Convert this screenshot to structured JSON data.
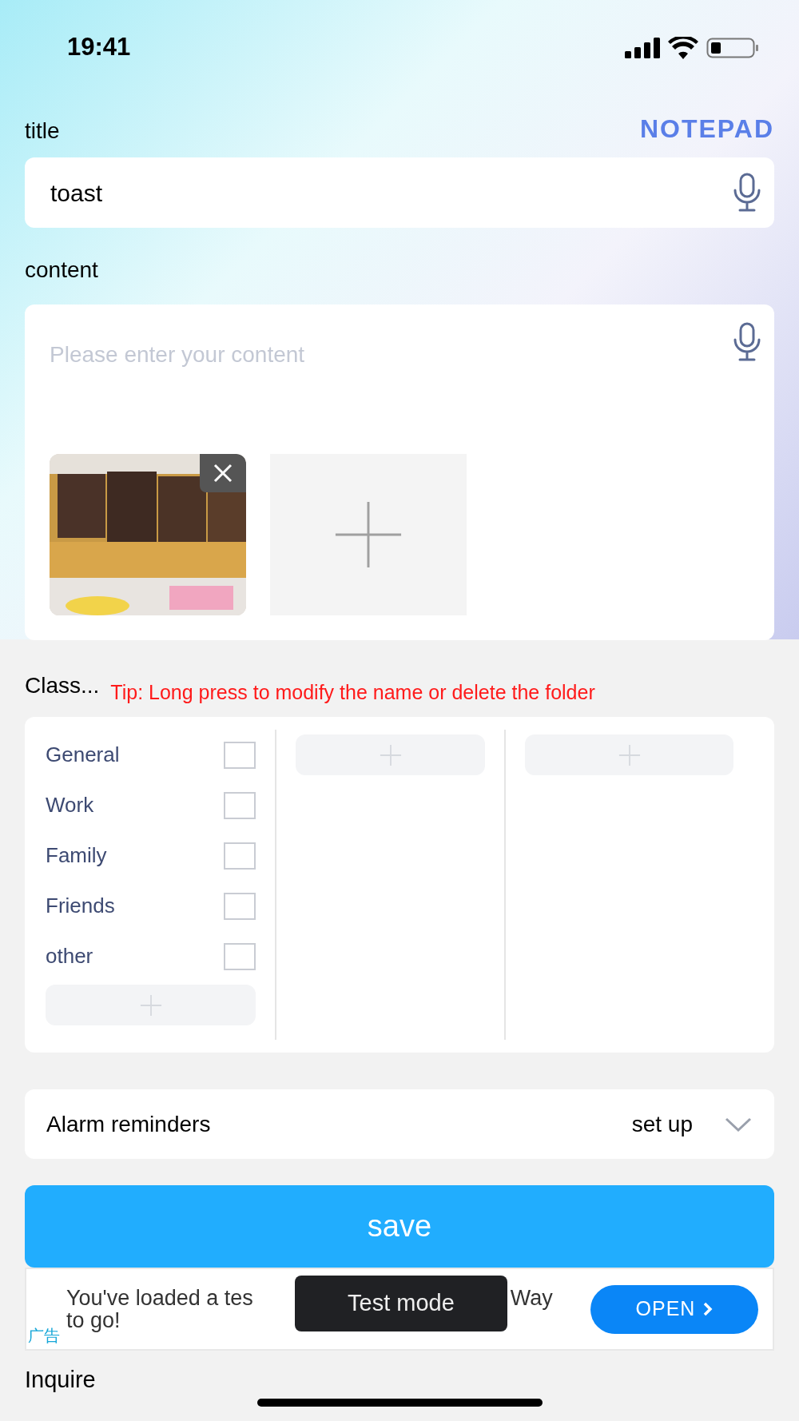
{
  "status_bar": {
    "time": "19:41"
  },
  "app_name": "NOTEPAD",
  "title_field": {
    "label": "title",
    "value": "toast"
  },
  "content_field": {
    "label": "content",
    "placeholder": "Please enter your content"
  },
  "classification": {
    "label": "Class...",
    "tip": "Tip: Long press to modify the name or delete the folder",
    "columns": [
      {
        "items": [
          {
            "name": "General",
            "checked": false
          },
          {
            "name": "Work",
            "checked": false
          },
          {
            "name": "Family",
            "checked": false
          },
          {
            "name": "Friends",
            "checked": false
          },
          {
            "name": "other",
            "checked": false
          }
        ]
      },
      {},
      {}
    ]
  },
  "alarm": {
    "label": "Alarm reminders",
    "value": "set up"
  },
  "save_button": "save",
  "ad": {
    "line_start": "You've loaded a tes",
    "line_end": "Way",
    "line_2": "to go!",
    "tag": "广告",
    "button": "OPEN",
    "toast": "Test mode"
  },
  "section_below": "Inquire"
}
